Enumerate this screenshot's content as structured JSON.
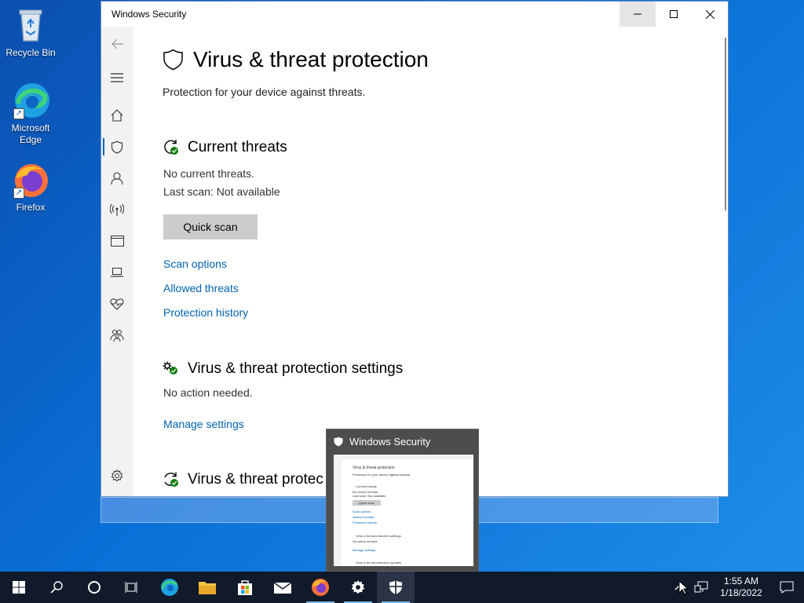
{
  "desktop": {
    "icons": [
      {
        "label": "Recycle Bin"
      },
      {
        "label": "Microsoft Edge"
      },
      {
        "label": "Firefox"
      }
    ]
  },
  "window": {
    "title": "Windows Security",
    "page_title": "Virus & threat protection",
    "subtitle": "Protection for your device against threats.",
    "current_threats": {
      "heading": "Current threats",
      "status": "No current threats.",
      "last_scan": "Last scan: Not available",
      "quick_scan_label": "Quick scan",
      "links": [
        "Scan options",
        "Allowed threats",
        "Protection history"
      ]
    },
    "settings": {
      "heading": "Virus & threat protection settings",
      "status": "No action needed.",
      "manage_link": "Manage settings"
    },
    "updates": {
      "heading": "Virus & threat protec"
    }
  },
  "thumbnail": {
    "title": "Windows Security",
    "mini_title": "Virus & threat protection",
    "mini_sub": "Protection for your device against threats.",
    "mini_current": "Current threats",
    "mini_status": "No current threats.",
    "mini_last": "Last scan: Not available",
    "mini_button": "Quick scan",
    "mini_links": [
      "Scan options",
      "Allowed threats",
      "Protection history"
    ],
    "mini_settings": "Virus & threat protection settings",
    "mini_settings_status": "No action needed.",
    "mini_manage": "Manage settings",
    "mini_updates": "Virus & threat protection updates"
  },
  "taskbar": {
    "clock_time": "1:55 AM",
    "clock_date": "1/18/2022"
  },
  "colors": {
    "accent": "#0063b1",
    "taskbar": "#101a2b",
    "nav_bg": "#f2f2f2"
  }
}
